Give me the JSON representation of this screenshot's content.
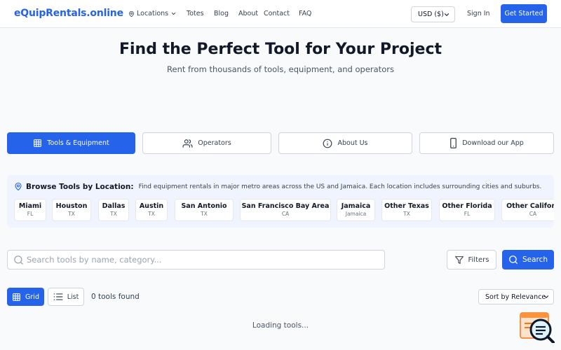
{
  "header": {
    "brand": "eQuipRentals.online",
    "nav": {
      "locations": "Locations",
      "totes": "Totes",
      "blog": "Blog",
      "about": "About",
      "contact": "Contact",
      "faq": "FAQ"
    },
    "currency": "USD ($)",
    "sign_in": "Sign In",
    "get_started": "Get Started"
  },
  "hero": {
    "title": "Find the Perfect Tool for Your Project",
    "subtitle": "Rent from thousands of tools, equipment, and operators"
  },
  "tabs": [
    {
      "label": "Tools & Equipment",
      "icon": "grid-icon",
      "active": true
    },
    {
      "label": "Operators",
      "icon": "users-icon",
      "active": false
    },
    {
      "label": "About Us",
      "icon": "info-icon",
      "active": false
    },
    {
      "label": "Download our App",
      "icon": "phone-icon",
      "active": false
    }
  ],
  "locations": {
    "title": "Browse Tools by Location:",
    "description": "Find equipment rentals in major metro areas across the US and Jamaica. Each location includes surrounding cities and suburbs.",
    "items": [
      {
        "name": "Miami",
        "sub": "FL"
      },
      {
        "name": "Houston",
        "sub": "TX"
      },
      {
        "name": "Dallas",
        "sub": "TX"
      },
      {
        "name": "Austin",
        "sub": "TX"
      },
      {
        "name": "San Antonio",
        "sub": "TX"
      },
      {
        "name": "San Francisco Bay Area",
        "sub": "CA"
      },
      {
        "name": "Jamaica",
        "sub": "Jamaica"
      },
      {
        "name": "Other Texas",
        "sub": "TX"
      },
      {
        "name": "Other Florida",
        "sub": "FL"
      },
      {
        "name": "Other Californ",
        "sub": "CA"
      }
    ]
  },
  "search": {
    "placeholder": "Search tools by name, category...",
    "value": "",
    "filters_label": "Filters",
    "search_label": "Search"
  },
  "view": {
    "grid_label": "Grid",
    "list_label": "List",
    "count_text": "0 tools found",
    "sort_value": "Sort by Relevance"
  },
  "status": {
    "loading": "Loading tools..."
  },
  "colors": {
    "primary": "#2563eb",
    "panel": "#eff4fe"
  }
}
